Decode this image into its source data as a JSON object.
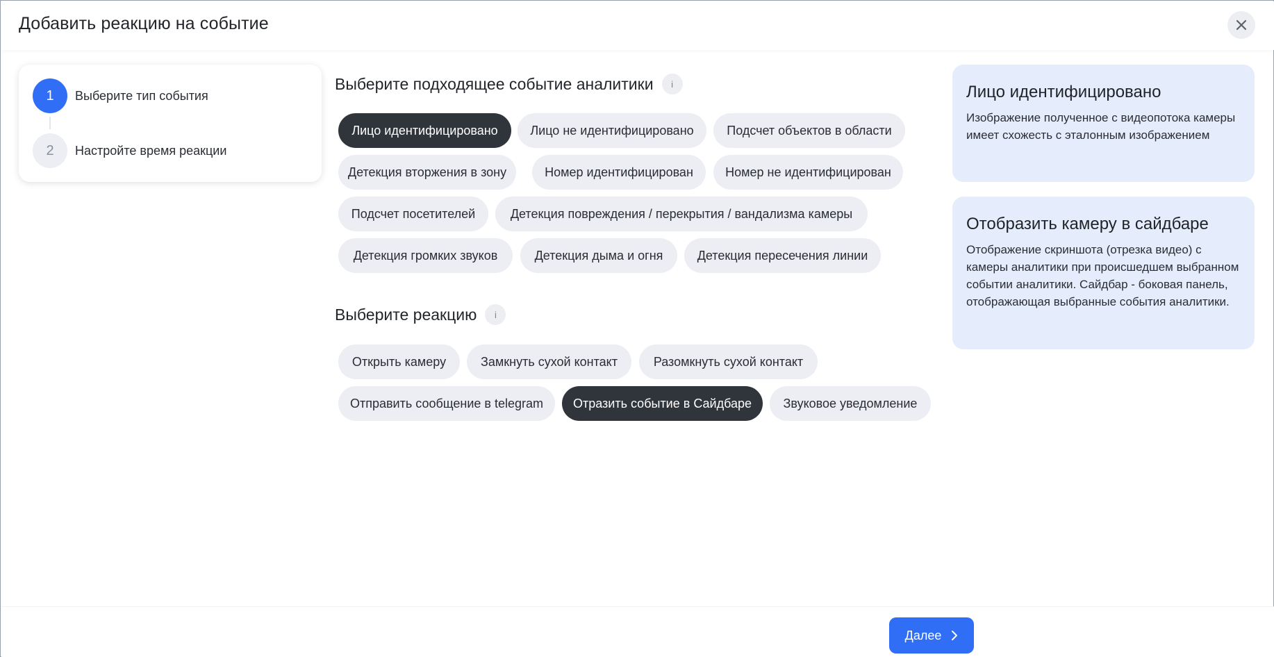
{
  "dialog": {
    "title": "Добавить реакцию на событие"
  },
  "icons": {
    "close": "close-icon",
    "info": "info-icon",
    "next": "chevron-right-icon"
  },
  "stepper": {
    "steps": [
      {
        "number": "1",
        "label": "Выберите тип события",
        "state": "active"
      },
      {
        "number": "2",
        "label": "Настройте время реакции",
        "state": "inactive"
      }
    ]
  },
  "events": {
    "title": "Выберите подходящее событие аналитики",
    "info_glyph": "i",
    "selected": "Лицо идентифицировано",
    "items": [
      "Лицо идентифицировано",
      "Лицо не идентифицировано",
      "Подсчет объектов в области",
      "Детекция вторжения в зону",
      "Номер идентифицирован",
      "Номер не идентифицирован",
      "Подсчет посетителей",
      "Детекция повреждения / перекрытия / вандализма камеры",
      "Детекция громких звуков",
      "Детекция дыма и огня",
      "Детекция пересечения линии"
    ]
  },
  "reactions": {
    "title": "Выберите реакцию",
    "info_glyph": "i",
    "selected": "Отразить событие в Сайдбаре",
    "items": [
      "Открыть камеру",
      "Замкнуть сухой контакт",
      "Разомкнуть сухой контакт",
      "Отправить сообщение в telegram",
      "Отразить событие в Сайдбаре",
      "Звуковое уведомление"
    ]
  },
  "info_cards": [
    {
      "title": "Лицо идентифицировано",
      "text": "Изображение полученное с видеопотока камеры имеет схожесть с эталонным изображением"
    },
    {
      "title": "Отобразить камеру в сайдбаре",
      "text": "Отображение скриншота (отрезка видео) с камеры аналитики при происшедшем выбранном событии аналитики. Сайдбар - боковая панель, отображающая выбранные события аналитики."
    }
  ],
  "footer": {
    "next_label": "Далее"
  },
  "colors": {
    "accent": "#2f6ef5",
    "chip_bg": "#eceef3",
    "chip_selected_bg": "#30343b",
    "card_bg": "#e5edfd"
  }
}
